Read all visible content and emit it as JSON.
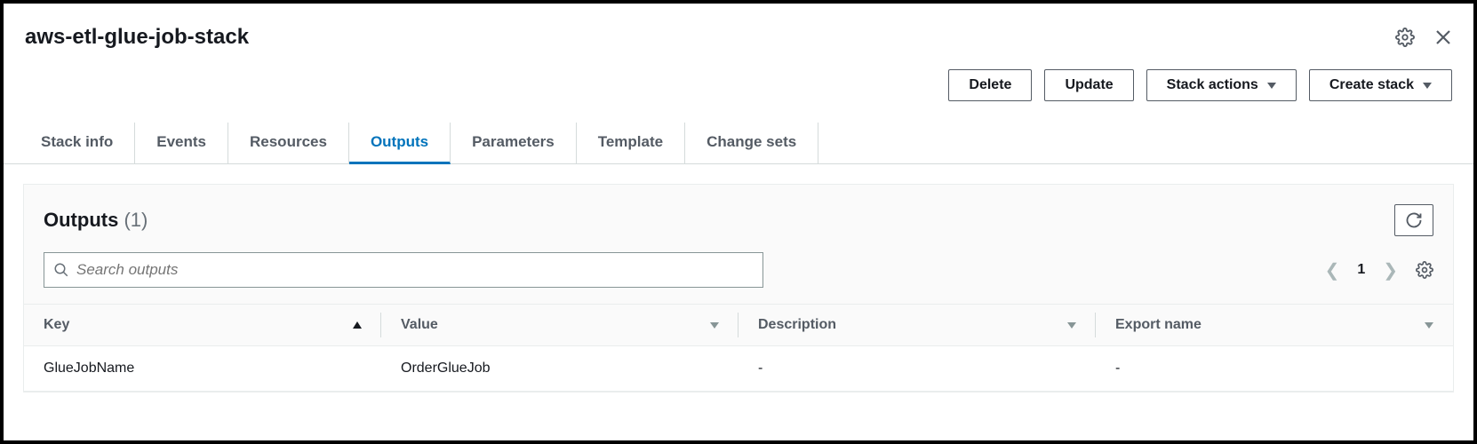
{
  "header": {
    "title": "aws-etl-glue-job-stack"
  },
  "toolbar": {
    "delete": "Delete",
    "update": "Update",
    "stack_actions": "Stack actions",
    "create_stack": "Create stack"
  },
  "tabs": [
    {
      "label": "Stack info",
      "active": false
    },
    {
      "label": "Events",
      "active": false
    },
    {
      "label": "Resources",
      "active": false
    },
    {
      "label": "Outputs",
      "active": true
    },
    {
      "label": "Parameters",
      "active": false
    },
    {
      "label": "Template",
      "active": false
    },
    {
      "label": "Change sets",
      "active": false
    }
  ],
  "panel": {
    "title": "Outputs",
    "count": "(1)",
    "search_placeholder": "Search outputs",
    "page": "1",
    "columns": {
      "key": "Key",
      "value": "Value",
      "description": "Description",
      "export_name": "Export name"
    },
    "rows": [
      {
        "key": "GlueJobName",
        "value": "OrderGlueJob",
        "description": "-",
        "export_name": "-"
      }
    ]
  }
}
